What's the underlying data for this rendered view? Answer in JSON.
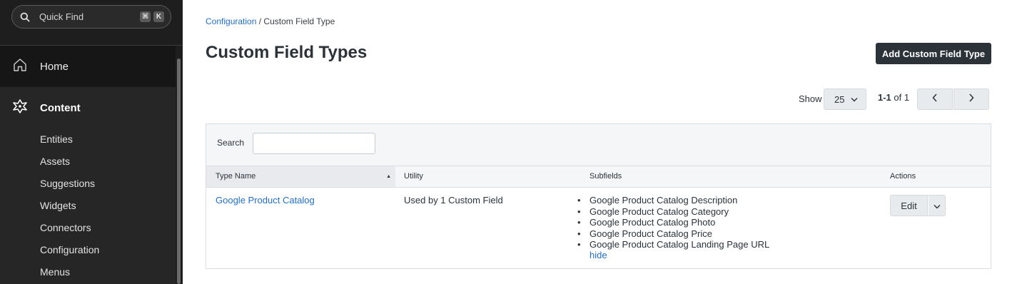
{
  "sidebar": {
    "quick_find": {
      "label": "Quick Find",
      "shortcut": [
        "⌘",
        "K"
      ]
    },
    "home": {
      "label": "Home",
      "icon": "home-icon"
    },
    "content": {
      "label": "Content",
      "icon": "content-hub-icon",
      "items": [
        {
          "label": "Entities"
        },
        {
          "label": "Assets"
        },
        {
          "label": "Suggestions"
        },
        {
          "label": "Widgets"
        },
        {
          "label": "Connectors"
        },
        {
          "label": "Configuration"
        },
        {
          "label": "Menus"
        }
      ]
    }
  },
  "breadcrumb": {
    "parent": "Configuration",
    "separator": "/",
    "current": "Custom Field Type"
  },
  "page": {
    "title": "Custom Field Types",
    "add_button": "Add Custom Field Type"
  },
  "pagination": {
    "show_label": "Show",
    "page_size": "25",
    "range": "1-1",
    "of_text": "of 1"
  },
  "filter": {
    "search_label": "Search",
    "search_value": ""
  },
  "table": {
    "headers": {
      "name": "Type Name",
      "utility": "Utility",
      "subfields": "Subfields",
      "actions": "Actions"
    },
    "rows": [
      {
        "name": "Google Product Catalog",
        "utility": "Used by 1 Custom Field",
        "subfields": [
          "Google Product Catalog Description",
          "Google Product Catalog Category",
          "Google Product Catalog Photo",
          "Google Product Catalog Price",
          "Google Product Catalog Landing Page URL"
        ],
        "hide_label": "hide",
        "edit_label": "Edit"
      }
    ]
  },
  "colors": {
    "accent_link": "#1f6fd0",
    "primary_button": "#2b3238",
    "sidebar_bg": "#1e1e1e"
  }
}
